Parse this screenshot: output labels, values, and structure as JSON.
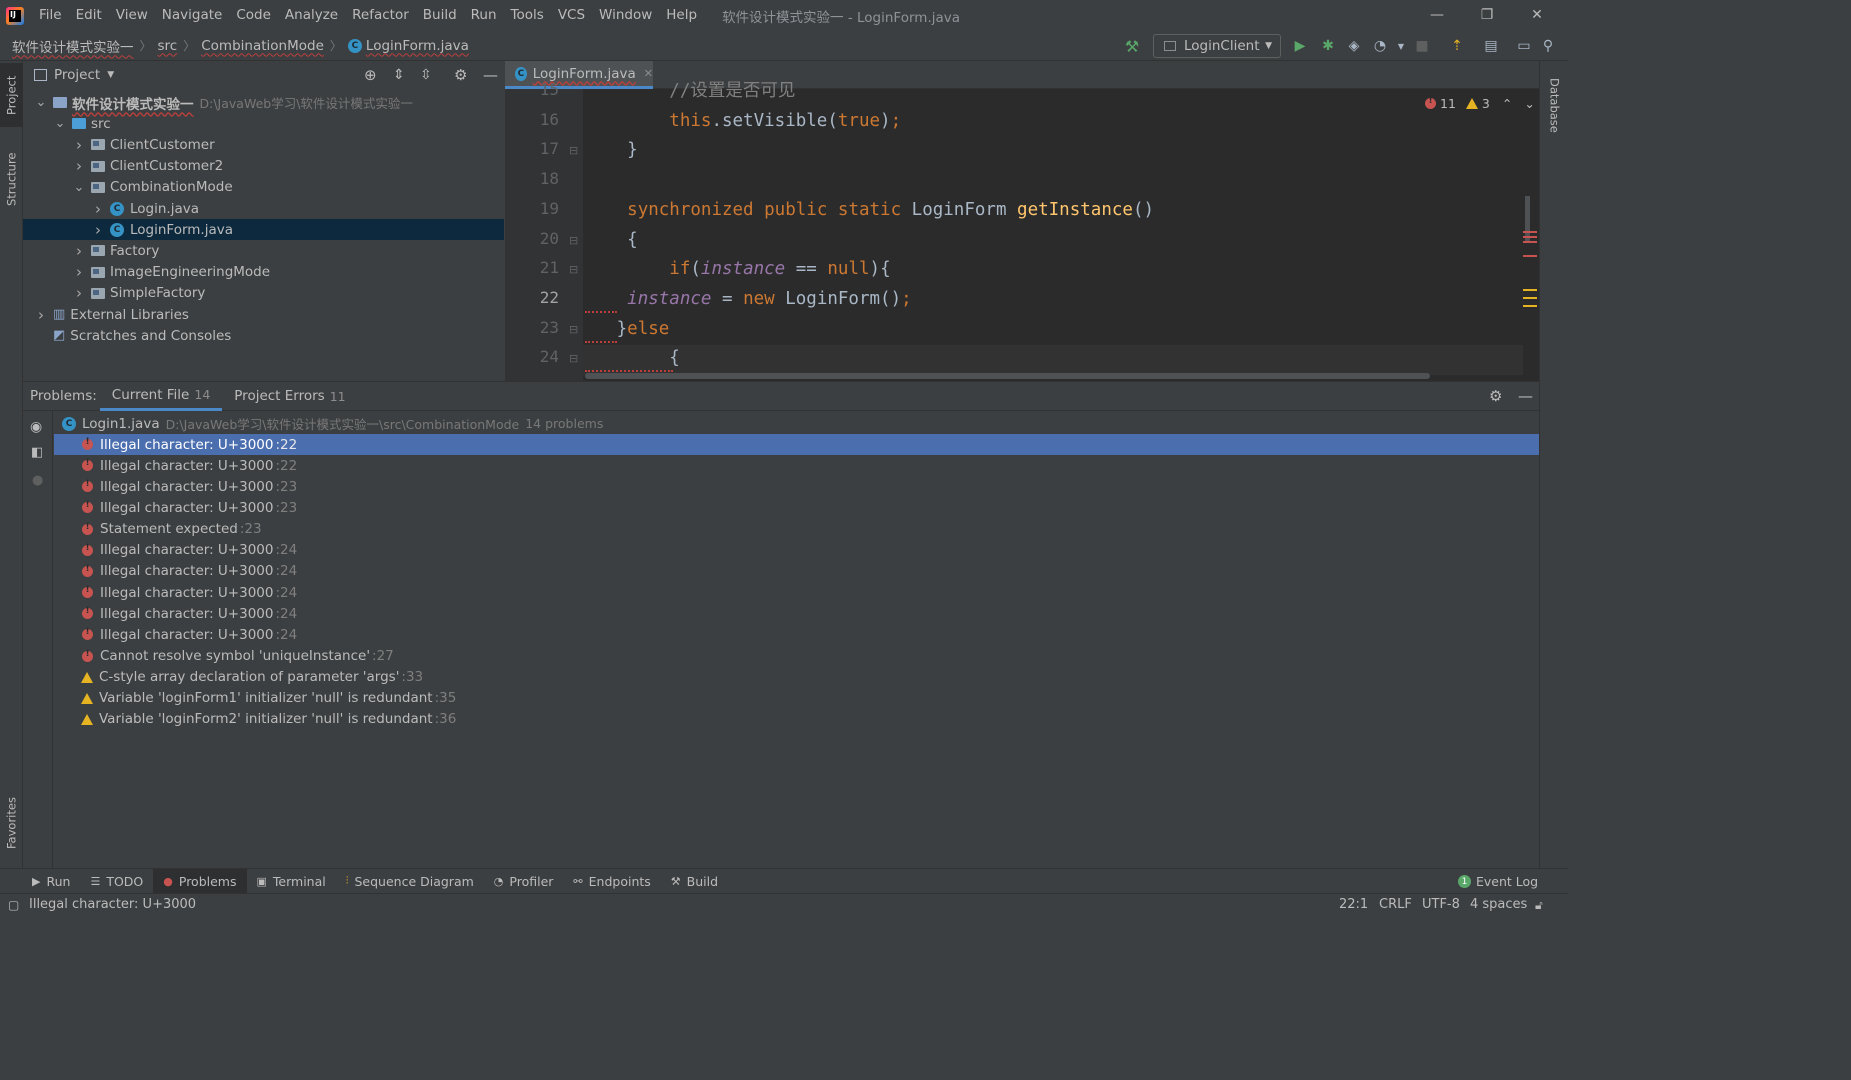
{
  "menu": {
    "logo_text": "IJ",
    "items": [
      "File",
      "Edit",
      "View",
      "Navigate",
      "Code",
      "Analyze",
      "Refactor",
      "Build",
      "Run",
      "Tools",
      "VCS",
      "Window",
      "Help"
    ],
    "window_title": "软件设计模式实验一 - LoginForm.java"
  },
  "window_controls": {
    "minimize": "—",
    "restore": "❐",
    "close": "✕"
  },
  "breadcrumb": [
    "软件设计模式实验一",
    "src",
    "CombinationMode",
    "LoginForm.java"
  ],
  "toolbar": {
    "run_config": "LoginClient"
  },
  "side_tabs": {
    "project": "Project",
    "structure": "Structure",
    "favorites": "Favorites",
    "database": "Database"
  },
  "project": {
    "title": "Project",
    "tree": [
      {
        "label": "软件设计模式实验一",
        "path": "D:\\JavaWeb学习\\软件设计模式实验一",
        "depth": 0,
        "expanded": true,
        "kind": "module"
      },
      {
        "label": "src",
        "depth": 1,
        "expanded": true,
        "kind": "src"
      },
      {
        "label": "ClientCustomer",
        "depth": 2,
        "expanded": false,
        "kind": "package"
      },
      {
        "label": "ClientCustomer2",
        "depth": 2,
        "expanded": false,
        "kind": "package"
      },
      {
        "label": "CombinationMode",
        "depth": 2,
        "expanded": true,
        "kind": "package"
      },
      {
        "label": "Login.java",
        "depth": 3,
        "expanded": false,
        "kind": "java"
      },
      {
        "label": "LoginForm.java",
        "depth": 3,
        "expanded": false,
        "kind": "java",
        "selected": true
      },
      {
        "label": "Factory",
        "depth": 2,
        "expanded": false,
        "kind": "package"
      },
      {
        "label": "ImageEngineeringMode",
        "depth": 2,
        "expanded": false,
        "kind": "package"
      },
      {
        "label": "SimpleFactory",
        "depth": 2,
        "expanded": false,
        "kind": "package"
      },
      {
        "label": "External Libraries",
        "depth": 0,
        "expanded": false,
        "kind": "libs"
      },
      {
        "label": "Scratches and Consoles",
        "depth": 0,
        "expanded": null,
        "kind": "scratch"
      }
    ]
  },
  "editor": {
    "tab_label": "LoginForm.java",
    "error_count": "11",
    "warning_count": "3",
    "lines": [
      {
        "num": "15",
        "code": "        //设置是否可见"
      },
      {
        "num": "16",
        "code": "        this.setVisible(true);"
      },
      {
        "num": "17",
        "code": "    }"
      },
      {
        "num": "18",
        "code": ""
      },
      {
        "num": "19",
        "code": "    synchronized public static LoginForm getInstance()"
      },
      {
        "num": "20",
        "code": "    {"
      },
      {
        "num": "21",
        "code": "        if(instance == null){"
      },
      {
        "num": "22",
        "code": "    instance = new LoginForm();"
      },
      {
        "num": "23",
        "code": "   }else"
      },
      {
        "num": "24",
        "code": "        {"
      }
    ]
  },
  "problems": {
    "label": "Problems:",
    "tabs": [
      {
        "label": "Current File",
        "count": "14",
        "active": true
      },
      {
        "label": "Project Errors",
        "count": "11",
        "active": false
      }
    ],
    "file": {
      "name": "Login1.java",
      "path": "D:\\JavaWeb学习\\软件设计模式实验一\\src\\CombinationMode",
      "summary": "14 problems"
    },
    "items": [
      {
        "severity": "error",
        "text": "Illegal character: U+3000",
        "line": ":22",
        "selected": true
      },
      {
        "severity": "error",
        "text": "Illegal character: U+3000",
        "line": ":22"
      },
      {
        "severity": "error",
        "text": "Illegal character: U+3000",
        "line": ":23"
      },
      {
        "severity": "error",
        "text": "Illegal character: U+3000",
        "line": ":23"
      },
      {
        "severity": "error",
        "text": "Statement expected",
        "line": ":23"
      },
      {
        "severity": "error",
        "text": "Illegal character: U+3000",
        "line": ":24"
      },
      {
        "severity": "error",
        "text": "Illegal character: U+3000",
        "line": ":24"
      },
      {
        "severity": "error",
        "text": "Illegal character: U+3000",
        "line": ":24"
      },
      {
        "severity": "error",
        "text": "Illegal character: U+3000",
        "line": ":24"
      },
      {
        "severity": "error",
        "text": "Illegal character: U+3000",
        "line": ":24"
      },
      {
        "severity": "error",
        "text": "Cannot resolve symbol 'uniqueInstance'",
        "line": ":27"
      },
      {
        "severity": "warning",
        "text": "C-style array declaration of parameter 'args'",
        "line": ":33"
      },
      {
        "severity": "warning",
        "text": "Variable 'loginForm1' initializer 'null' is redundant",
        "line": ":35"
      },
      {
        "severity": "warning",
        "text": "Variable 'loginForm2' initializer 'null' is redundant",
        "line": ":36"
      }
    ]
  },
  "bottom_tabs": [
    {
      "label": "Run",
      "icon": "run-icon",
      "active": false
    },
    {
      "label": "TODO",
      "icon": "todo-icon",
      "active": false
    },
    {
      "label": "Problems",
      "icon": "problems-icon",
      "active": true
    },
    {
      "label": "Terminal",
      "icon": "terminal-icon",
      "active": false
    },
    {
      "label": "Sequence Diagram",
      "icon": "sequence-diagram-icon",
      "active": false
    },
    {
      "label": "Profiler",
      "icon": "profiler-icon",
      "active": false
    },
    {
      "label": "Endpoints",
      "icon": "endpoints-icon",
      "active": false
    },
    {
      "label": "Build",
      "icon": "build-icon",
      "active": false
    }
  ],
  "event_log": {
    "label": "Event Log",
    "badge": "1"
  },
  "status": {
    "message": "Illegal character: U+3000",
    "position": "22:1",
    "line_sep": "CRLF",
    "encoding": "UTF-8",
    "indent": "4 spaces"
  },
  "colors": {
    "accent": "#4a88c7",
    "error": "#c75450",
    "warning": "#e6b422",
    "selection": "#4b6eaf"
  }
}
